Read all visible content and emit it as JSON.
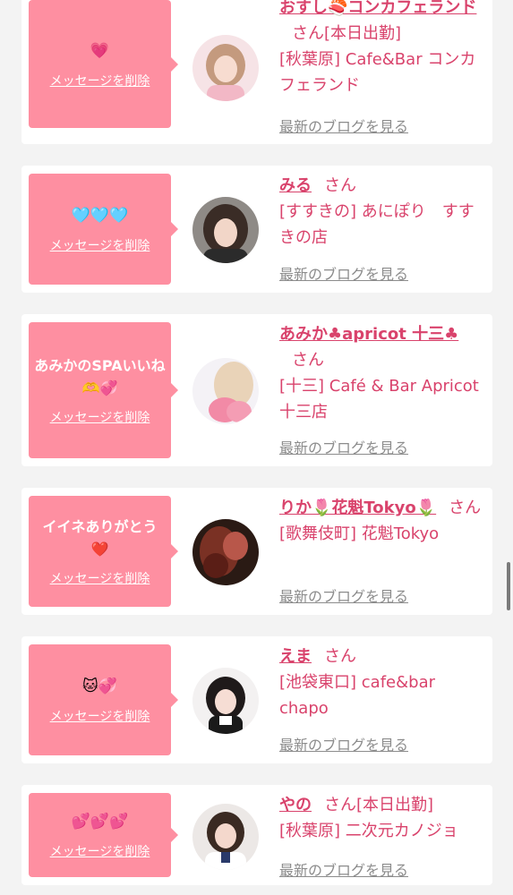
{
  "delete_label": "メッセージを削除",
  "blog_label": "最新のブログを見る",
  "san": "さん",
  "colors": {
    "bubble": "#fe8fa1",
    "accent": "#d9436c",
    "muted": "#8c8c8c"
  },
  "items": [
    {
      "message": "",
      "emoji": "💗",
      "name": "おすし🍣コンカフェランド",
      "status": "[本日出勤]",
      "shop": "[秋葉原] Cafe&Bar コンカフェランド",
      "avatar": "avatar-girl-light"
    },
    {
      "message": "",
      "emoji": "🩵🩵🩵",
      "name": "みる",
      "status": "",
      "shop": "[すすきの] あにぽり　すすきの店",
      "avatar": "avatar-girl-dark"
    },
    {
      "message": "あみかのSPAいいね🫶💞",
      "emoji": "",
      "name": "あみか♣apricot 十三♣",
      "status": "",
      "shop": "[十三] Café & Bar Apricot 十三店",
      "avatar": "avatar-blurred"
    },
    {
      "message": "イイネありがとう❤️",
      "emoji": "",
      "name": "りか🌷花魁Tokyo🌷",
      "status": "",
      "shop": "[歌舞伎町] 花魁Tokyo",
      "avatar": "avatar-kimono"
    },
    {
      "message": "",
      "emoji": "🐱💞",
      "name": "えま",
      "status": "",
      "shop": "[池袋東口] cafe&bar chapo",
      "avatar": "avatar-twin-tails"
    },
    {
      "message": "",
      "emoji": "💕💕💕",
      "name": "やの",
      "status": "[本日出勤]",
      "shop": "[秋葉原] 二次元カノジョ",
      "avatar": "avatar-uniform"
    }
  ]
}
